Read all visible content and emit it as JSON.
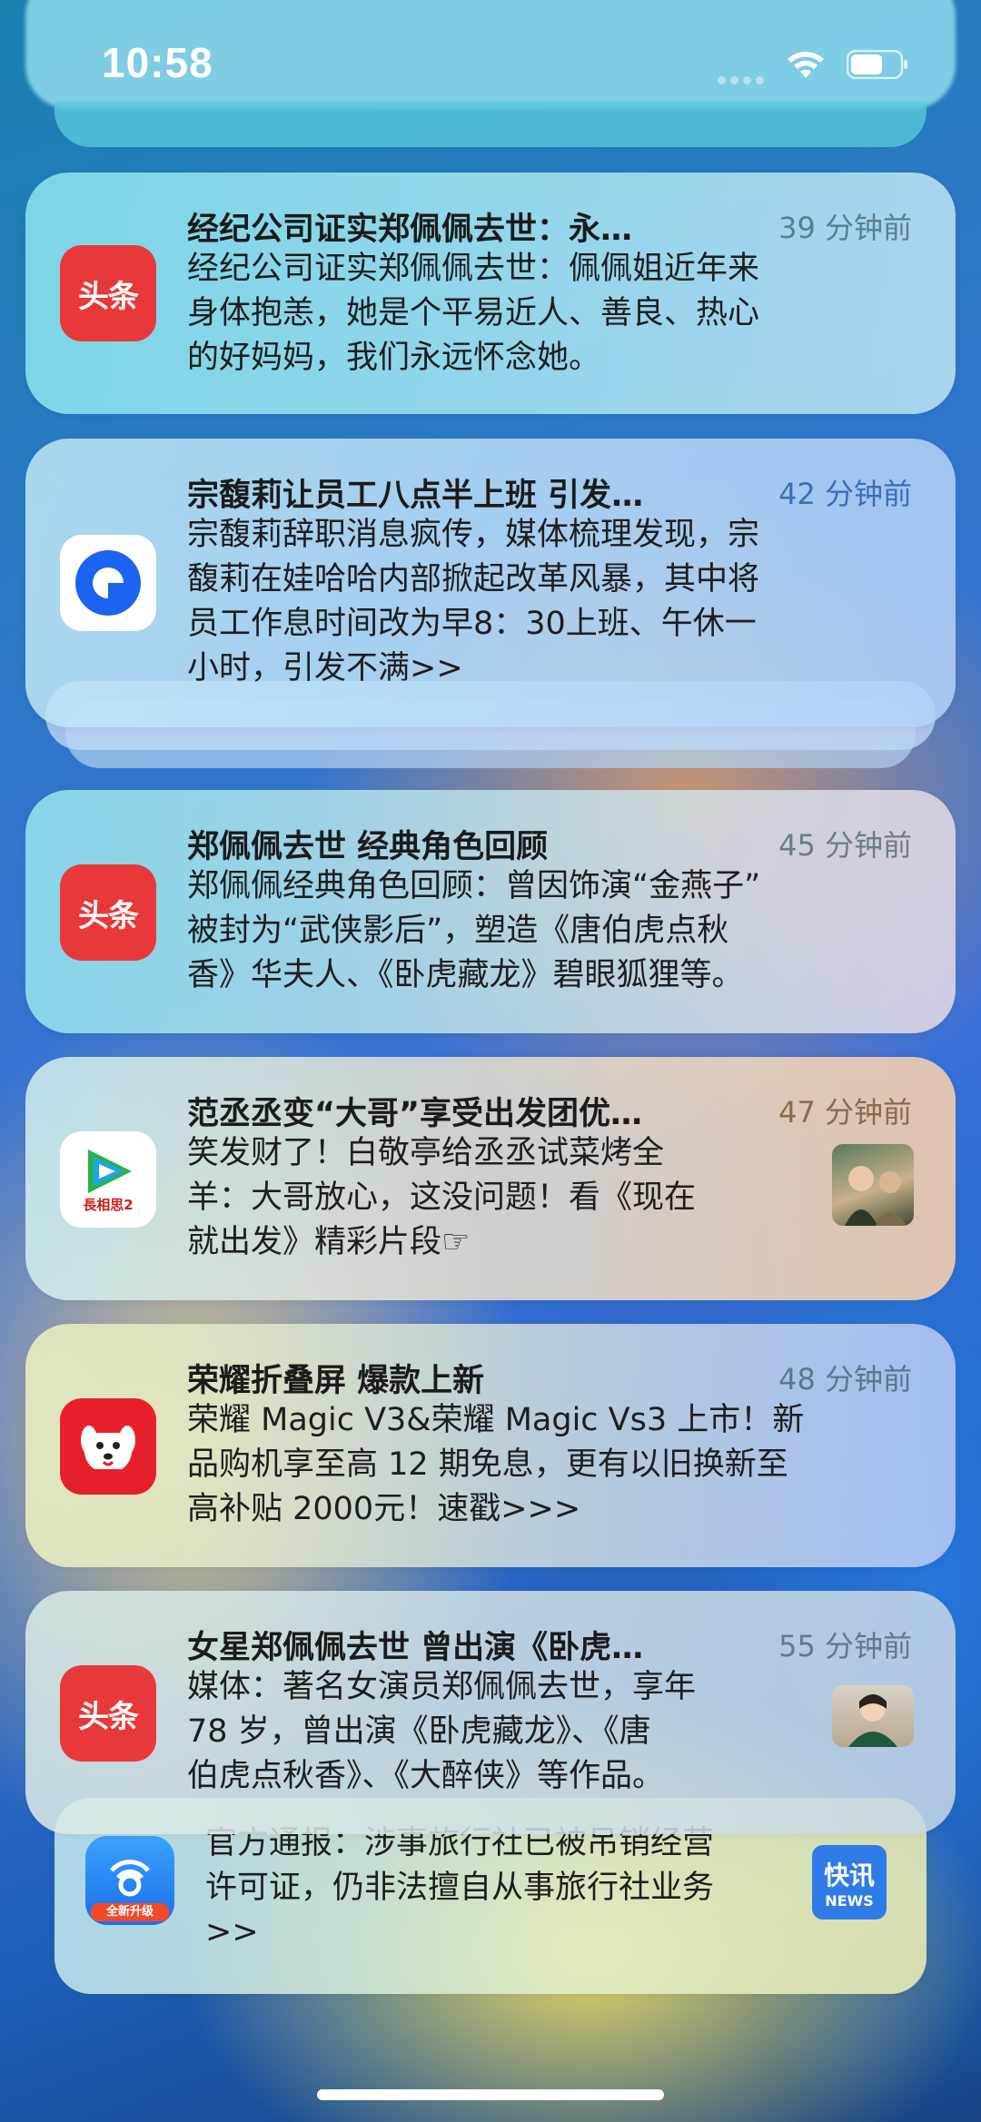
{
  "status_bar": {
    "time": "10:58"
  },
  "notifications": [
    {
      "app": "toutiao-icon",
      "icon_text": "头条",
      "title": "经纪公司证实郑佩佩去世：永…",
      "time_ago": "39 分钟前",
      "body": [
        "经纪公司证实郑佩佩去世：佩佩姐近年来",
        "身体抱恙，她是个平易近人、善良、热心",
        "的好妈妈，我们永远怀念她。"
      ]
    },
    {
      "app": "blue-circle-icon",
      "title": "宗馥莉让员工八点半上班 引发…",
      "time_ago": "42 分钟前",
      "body": [
        "宗馥莉辞职消息疯传，媒体梳理发现，宗",
        "馥莉在娃哈哈内部掀起改革风暴，其中将",
        "员工作息时间改为早8：30上班、午休一",
        "小时，引发不满>>"
      ]
    },
    {
      "app": "toutiao-icon",
      "icon_text": "头条",
      "title": "郑佩佩去世 经典角色回顾",
      "time_ago": "45 分钟前",
      "body": [
        "郑佩佩经典角色回顾：曾因饰演“金燕子”",
        "被封为“武侠影后”，塑造《唐伯虎点秋",
        "香》华夫人、《卧虎藏龙》碧眼狐狸等。"
      ]
    },
    {
      "app": "tencent-video-icon",
      "icon_text": "長相思2",
      "title": "范丞丞变“大哥”享受出发团优…",
      "time_ago": "47 分钟前",
      "body": [
        "笑发财了！白敬亭给丞丞试菜烤全",
        "羊：大哥放心，这没问题！看《现在",
        "就出发》精彩片段☞"
      ]
    },
    {
      "app": "jd-icon",
      "title": "荣耀折叠屏 爆款上新",
      "time_ago": "48 分钟前",
      "body": [
        "荣耀 Magic V3&荣耀 Magic Vs3 上市！新",
        "品购机享至高 12 期免息，更有以旧换新至",
        "高补贴 2000元！速戳>>>"
      ]
    },
    {
      "app": "toutiao-icon",
      "icon_text": "头条",
      "title": "女星郑佩佩去世 曾出演《卧虎…",
      "time_ago": "55 分钟前",
      "body": [
        "媒体：著名女演员郑佩佩去世，享年",
        "78 岁，曾出演《卧虎藏龙》、《唐",
        "伯虎点秋香》、《大醉侠》等作品。"
      ]
    },
    {
      "app": "ccb-icon",
      "icon_badge": "全新升级",
      "body": [
        "官方通报：涉事旅行社已被吊销经营",
        "许可证，仍非法擅自从事旅行社业务",
        ">>"
      ],
      "thumb_text_1": "快讯",
      "thumb_text_2": "NEWS"
    }
  ],
  "colors": {
    "toutiao_red": "#e8393a",
    "jd_red": "#e6202a",
    "time_gray": "#5b7a82"
  }
}
